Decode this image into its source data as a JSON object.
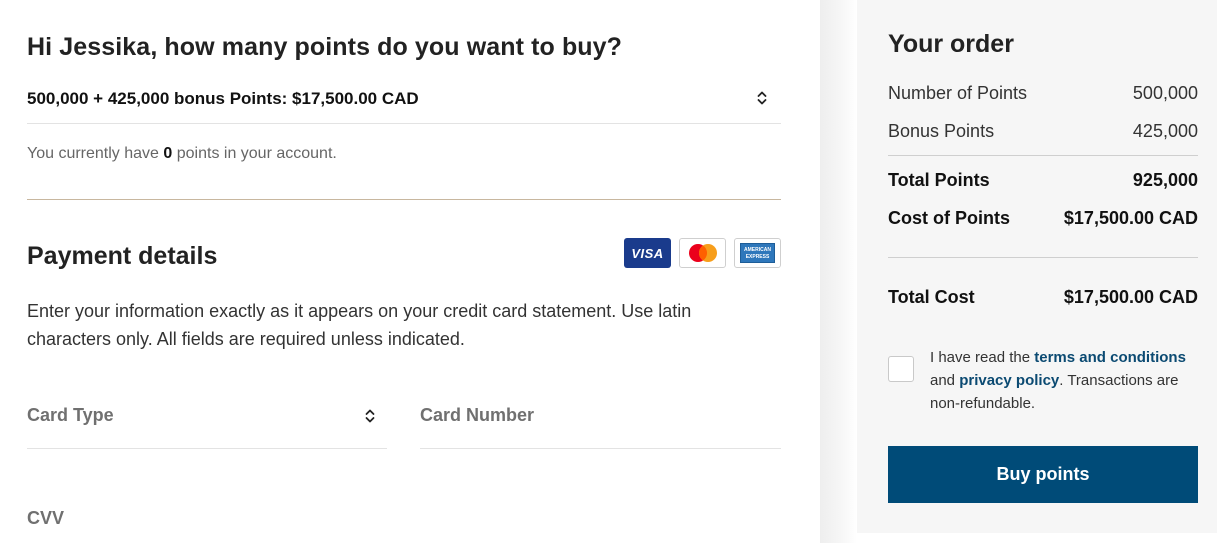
{
  "greeting": "Hi Jessika, how many points do you want to buy?",
  "points_select": {
    "value": "500,000 + 425,000 bonus Points: $17,500.00 CAD"
  },
  "current_points": {
    "prefix": "You currently have ",
    "count": "0",
    "suffix": " points in your account."
  },
  "payment": {
    "title": "Payment details",
    "card_logos": [
      "VISA",
      "Mastercard",
      "American Express"
    ],
    "visa_text": "VISA",
    "amex_text": "AMERICAN EXPRESS",
    "instructions": "Enter your information exactly as it appears on your credit card statement. Use latin characters only. All fields are required unless indicated.",
    "fields": {
      "card_type": "Card Type",
      "card_number": "Card Number",
      "cvv": "CVV"
    }
  },
  "order": {
    "title": "Your order",
    "rows": [
      {
        "label": "Number of Points",
        "value": "500,000"
      },
      {
        "label": "Bonus Points",
        "value": "425,000"
      },
      {
        "label": "Total Points",
        "value": "925,000"
      },
      {
        "label": "Cost of Points",
        "value": "$17,500.00 CAD"
      },
      {
        "label": "Total Cost",
        "value": "$17,500.00 CAD"
      }
    ],
    "terms": {
      "prefix": "I have read the ",
      "terms_link": "terms and conditions",
      "middle": " and ",
      "privacy_link": "privacy policy",
      "suffix": ". Transactions are non-refundable."
    },
    "buy_label": "Buy points"
  },
  "colors": {
    "accent": "#004b78",
    "link": "#0b4a72",
    "divider_tan": "#c8b79f",
    "visa_blue": "#1a3b8c"
  }
}
